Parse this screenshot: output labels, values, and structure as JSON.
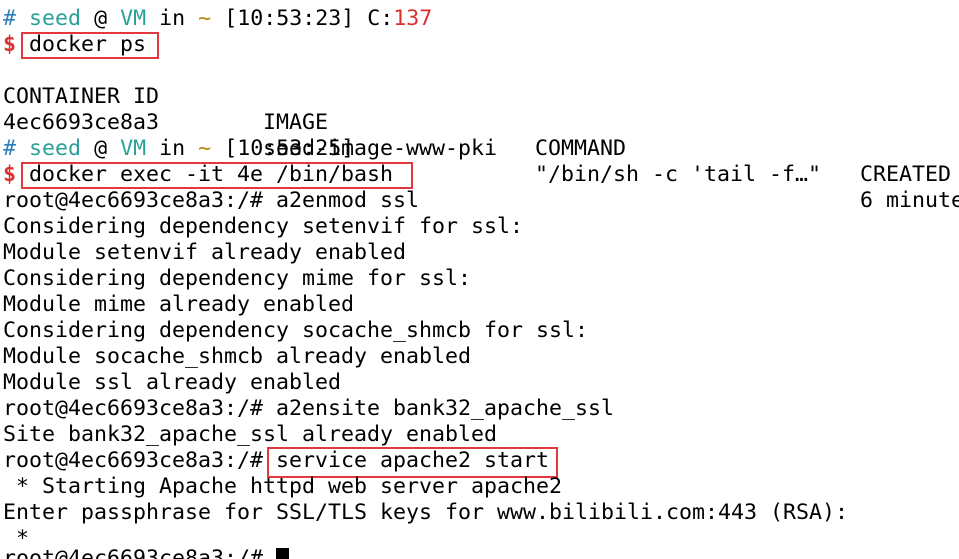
{
  "prompt1": {
    "hash": "#",
    "user": "seed",
    "at": "@",
    "host": "VM",
    "in": "in",
    "dir": "~",
    "time": "[10:53:23]",
    "c_label": "C:",
    "c_code": "137"
  },
  "cmd1": {
    "dollar": "$",
    "text": "docker ps"
  },
  "ps_table": {
    "headers": [
      "CONTAINER ID",
      "IMAGE",
      "COMMAND",
      "CREATED"
    ],
    "row": [
      "4ec6693ce8a3",
      "seed-image-www-pki",
      "\"/bin/sh -c 'tail -f…\"",
      "6 minute"
    ]
  },
  "prompt2": {
    "hash": "#",
    "user": "seed",
    "at": "@",
    "host": "VM",
    "in": "in",
    "dir": "~",
    "time": "[10:53:25]"
  },
  "cmd2": {
    "dollar": "$",
    "text": "docker exec -it 4e /bin/bash"
  },
  "root_prompt": "root@4ec6693ce8a3:/#",
  "output_lines": [
    "root@4ec6693ce8a3:/# a2enmod ssl",
    "Considering dependency setenvif for ssl:",
    "Module setenvif already enabled",
    "Considering dependency mime for ssl:",
    "Module mime already enabled",
    "Considering dependency socache_shmcb for ssl:",
    "Module socache_shmcb already enabled",
    "Module ssl already enabled",
    "root@4ec6693ce8a3:/# a2ensite bank32_apache_ssl",
    "Site bank32_apache_ssl already enabled"
  ],
  "cmd3": {
    "prompt": "root@4ec6693ce8a3:/#",
    "text": "service apache2 start"
  },
  "after_lines": [
    " * Starting Apache httpd web server apache2",
    "Enter passphrase for SSL/TLS keys for www.bilibili.com:443 (RSA):",
    " *"
  ],
  "last_prompt": "root@4ec6693ce8a3:/#"
}
